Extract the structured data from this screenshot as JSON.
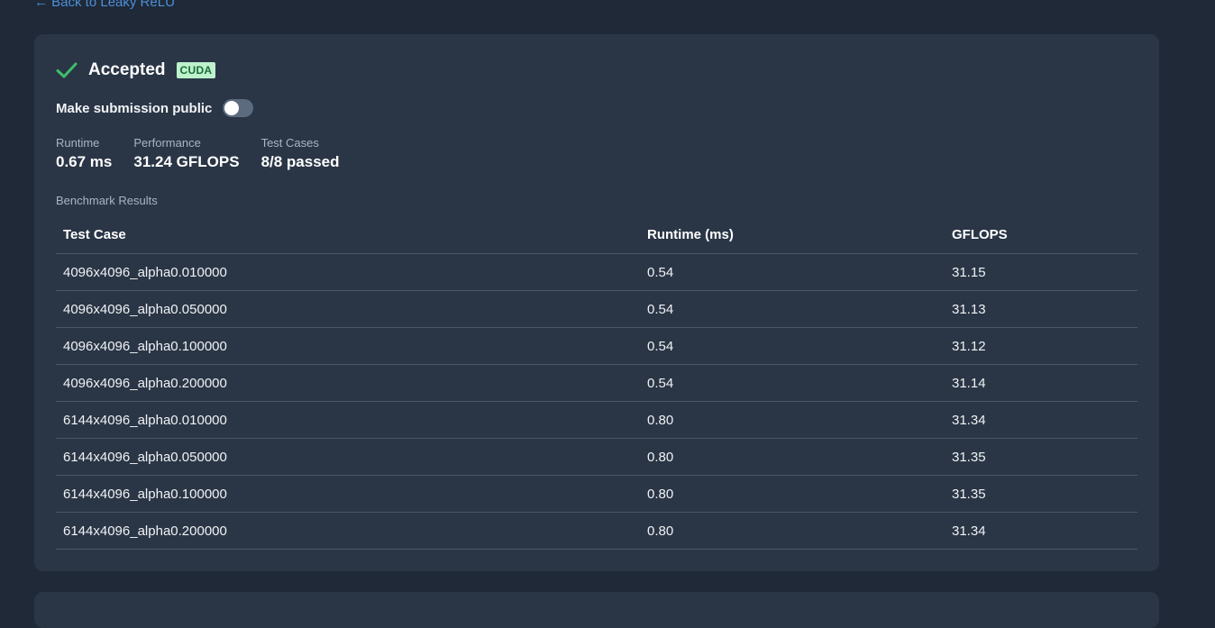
{
  "nav": {
    "back_label": "← Back to Leaky ReLU"
  },
  "submission": {
    "status": "Accepted",
    "status_color": "#3fbf6b",
    "language_badge": "CUDA",
    "public_label": "Make submission public",
    "public_enabled": false
  },
  "stats": [
    {
      "label": "Runtime",
      "value": "0.67 ms"
    },
    {
      "label": "Performance",
      "value": "31.24 GFLOPS"
    },
    {
      "label": "Test Cases",
      "value": "8/8 passed"
    }
  ],
  "benchmark": {
    "title": "Benchmark Results",
    "columns": [
      "Test Case",
      "Runtime (ms)",
      "GFLOPS"
    ],
    "rows": [
      [
        "4096x4096_alpha0.010000",
        "0.54",
        "31.15"
      ],
      [
        "4096x4096_alpha0.050000",
        "0.54",
        "31.13"
      ],
      [
        "4096x4096_alpha0.100000",
        "0.54",
        "31.12"
      ],
      [
        "4096x4096_alpha0.200000",
        "0.54",
        "31.14"
      ],
      [
        "6144x4096_alpha0.010000",
        "0.80",
        "31.34"
      ],
      [
        "6144x4096_alpha0.050000",
        "0.80",
        "31.35"
      ],
      [
        "6144x4096_alpha0.100000",
        "0.80",
        "31.35"
      ],
      [
        "6144x4096_alpha0.200000",
        "0.80",
        "31.34"
      ]
    ]
  }
}
